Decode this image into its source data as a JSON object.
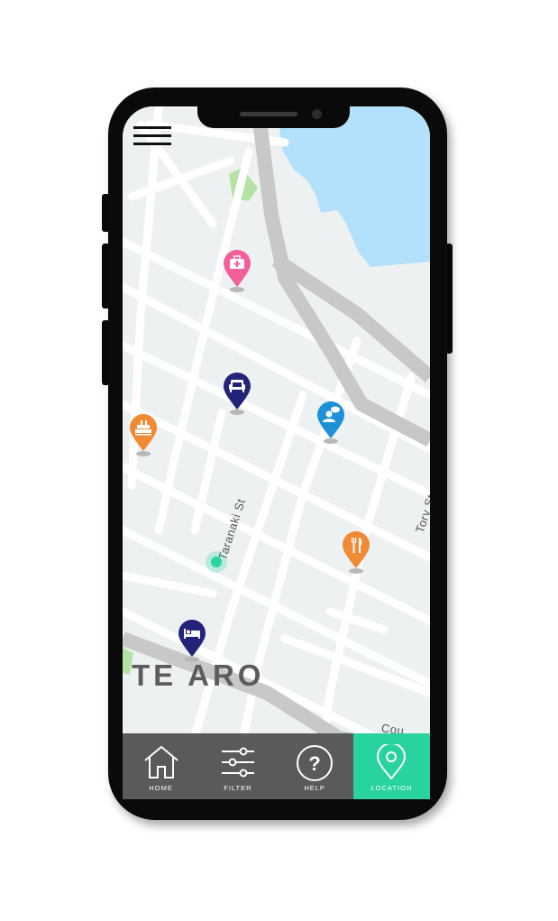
{
  "map": {
    "district_label": "TE ARO",
    "streets": {
      "taranaki": "Taranaki St",
      "tory": "Tory St",
      "cou": "Cou"
    }
  },
  "pins": [
    {
      "name": "first-aid-pin",
      "icon": "first-aid-kit-icon",
      "color": "#f2609b"
    },
    {
      "name": "accommodation-pin-1",
      "icon": "sofa-icon",
      "color": "#24237a"
    },
    {
      "name": "cafe-pin",
      "icon": "person-speech-icon",
      "color": "#1e90d6"
    },
    {
      "name": "landmark-pin",
      "icon": "ship-icon",
      "color": "#f08a34"
    },
    {
      "name": "restaurant-pin",
      "icon": "fork-knife-icon",
      "color": "#f08a34"
    },
    {
      "name": "accommodation-pin-2",
      "icon": "bed-icon",
      "color": "#24237a"
    }
  ],
  "nav": {
    "home": "HOME",
    "filter": "FILTER",
    "help": "HELP",
    "location": "LOCATION"
  },
  "colors": {
    "accent": "#29d3a0",
    "navbar": "#5a5a5a",
    "water": "#b3e0fa",
    "park": "#b6e3a5",
    "current_location": "#29d3a0"
  }
}
